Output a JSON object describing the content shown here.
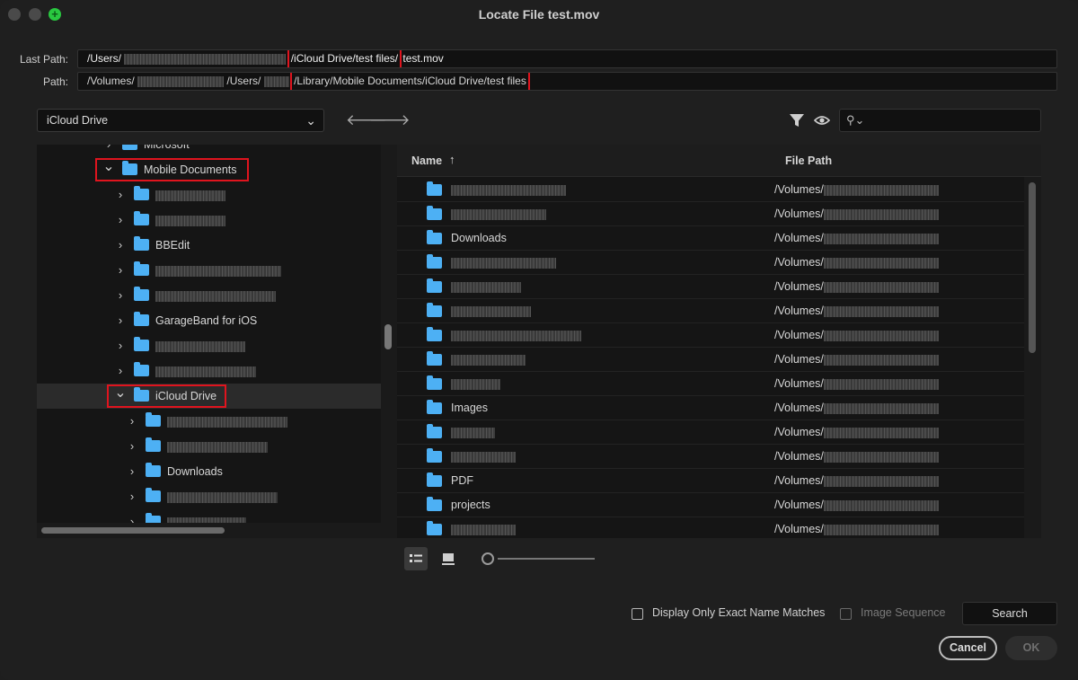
{
  "window": {
    "title": "Locate File test.mov"
  },
  "paths": {
    "last_path_label": "Last Path:",
    "last_path_prefix": "/Users/",
    "last_path_highlight": "/iCloud Drive/test files/",
    "last_path_suffix": "test.mov",
    "path_label": "Path:",
    "path_prefix": "/Volumes/",
    "path_mid": "/Users/",
    "path_highlight": "/Library/Mobile Documents/iCloud Drive/test files"
  },
  "toolbar": {
    "location": "iCloud Drive",
    "search_placeholder": ""
  },
  "tree": {
    "rows": [
      {
        "label": "Microsoft",
        "level": 1,
        "expanded": false,
        "redacted": false
      },
      {
        "label": "Mobile Documents",
        "level": 1,
        "expanded": true,
        "redacted": false
      },
      {
        "label": "",
        "level": 2,
        "expanded": false,
        "redacted": true
      },
      {
        "label": "",
        "level": 2,
        "expanded": false,
        "redacted": true
      },
      {
        "label": "BBEdit",
        "level": 2,
        "expanded": false,
        "redacted": false
      },
      {
        "label": "",
        "level": 2,
        "expanded": false,
        "redacted": true
      },
      {
        "label": "",
        "level": 2,
        "expanded": false,
        "redacted": true
      },
      {
        "label": "GarageBand for iOS",
        "level": 2,
        "expanded": false,
        "redacted": false
      },
      {
        "label": "",
        "level": 2,
        "expanded": false,
        "redacted": true
      },
      {
        "label": "",
        "level": 2,
        "expanded": false,
        "redacted": true
      },
      {
        "label": "iCloud Drive",
        "level": 2,
        "expanded": true,
        "redacted": false,
        "selected": true
      },
      {
        "label": "",
        "level": 3,
        "expanded": false,
        "redacted": true
      },
      {
        "label": "",
        "level": 3,
        "expanded": false,
        "redacted": true
      },
      {
        "label": "Downloads",
        "level": 3,
        "expanded": false,
        "redacted": false
      },
      {
        "label": "",
        "level": 3,
        "expanded": false,
        "redacted": true
      },
      {
        "label": "",
        "level": 3,
        "expanded": false,
        "redacted": true
      }
    ]
  },
  "files": {
    "col_name": "Name",
    "col_path": "File Path",
    "sort_indicator": "↑",
    "path_prefix": "/Volumes/",
    "rows": [
      {
        "name": "",
        "redacted": true
      },
      {
        "name": "",
        "redacted": true
      },
      {
        "name": "Downloads",
        "redacted": false
      },
      {
        "name": "",
        "redacted": true
      },
      {
        "name": "",
        "redacted": true
      },
      {
        "name": "",
        "redacted": true
      },
      {
        "name": "",
        "redacted": true
      },
      {
        "name": "",
        "redacted": true
      },
      {
        "name": "",
        "redacted": true
      },
      {
        "name": "Images",
        "redacted": false
      },
      {
        "name": "",
        "redacted": true
      },
      {
        "name": "",
        "redacted": true
      },
      {
        "name": "PDF",
        "redacted": false
      },
      {
        "name": "projects",
        "redacted": false
      },
      {
        "name": "",
        "redacted": true
      }
    ]
  },
  "options": {
    "exact_match_label": "Display Only Exact Name Matches",
    "exact_match_checked": false,
    "image_sequence_label": "Image Sequence",
    "image_sequence_checked": false,
    "image_sequence_enabled": false
  },
  "buttons": {
    "search": "Search",
    "cancel": "Cancel",
    "ok": "OK"
  },
  "colors": {
    "highlight": "#e0141e",
    "folder": "#4db0f4",
    "zoom_button": "#29c840"
  }
}
